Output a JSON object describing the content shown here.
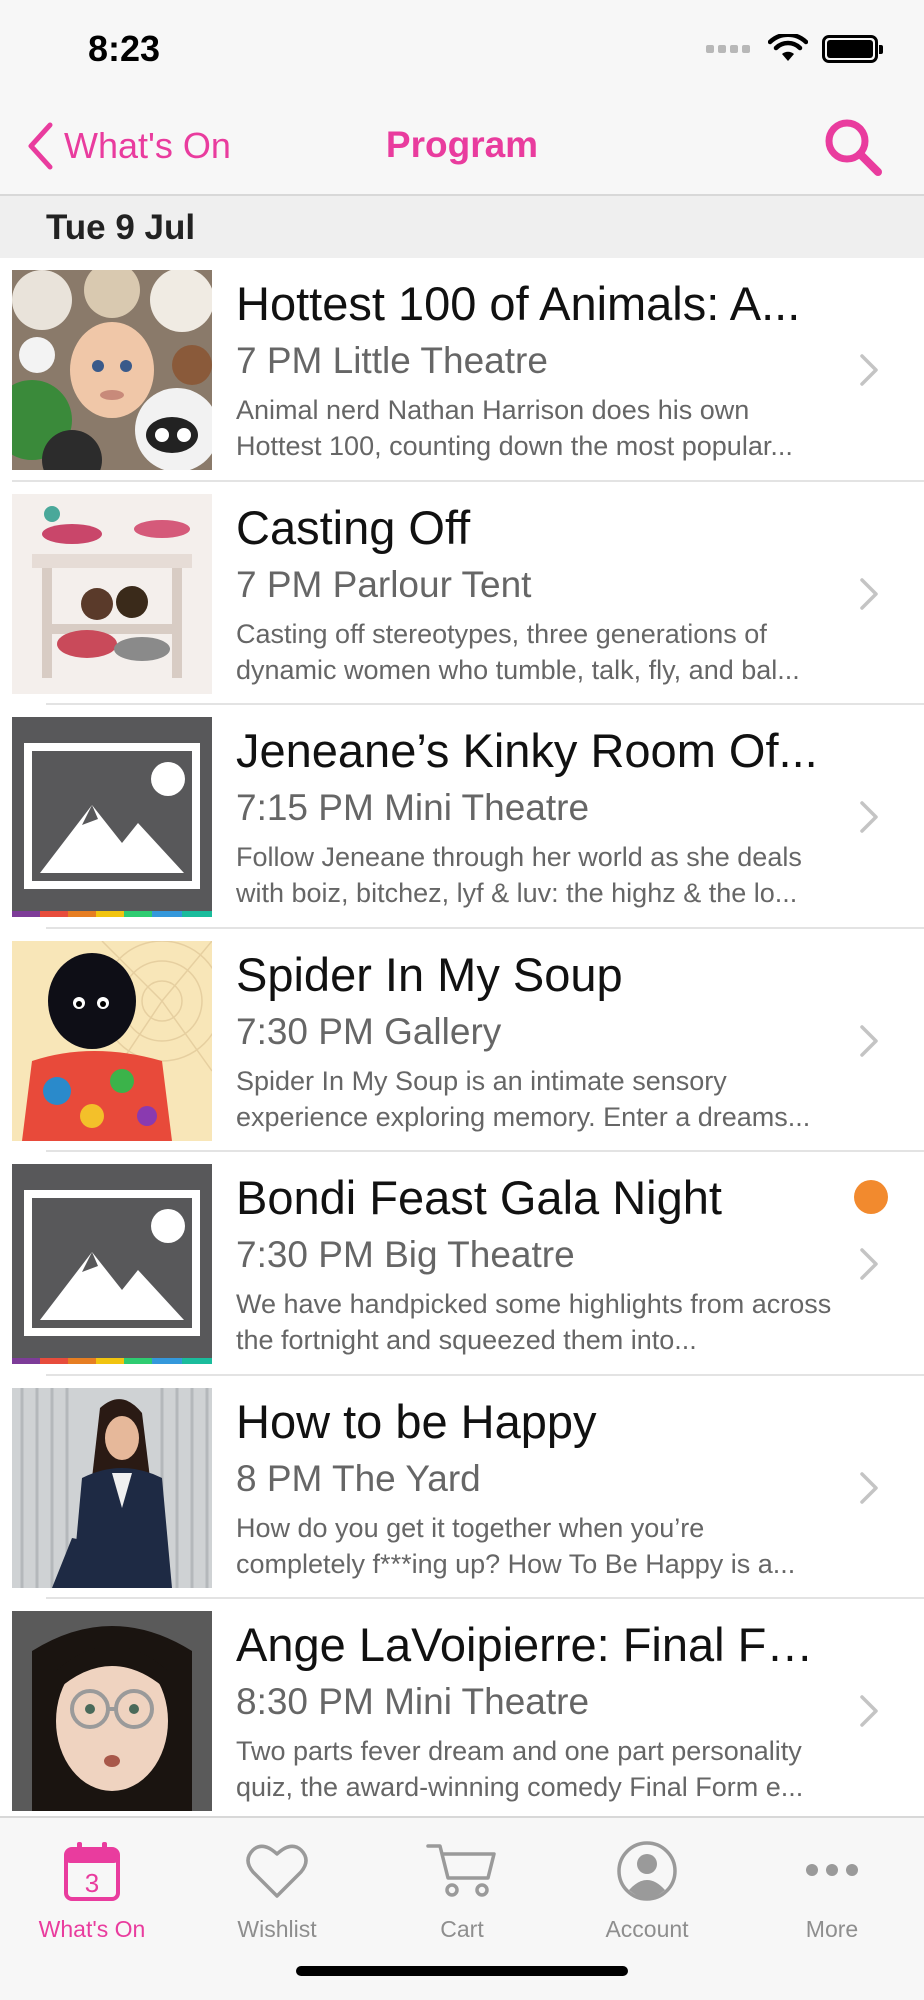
{
  "status_bar": {
    "time": "8:23"
  },
  "nav": {
    "back_label": "What's On",
    "title": "Program",
    "accent_color": "#e93c9e"
  },
  "section": {
    "date": "Tue 9 Jul"
  },
  "events": [
    {
      "title": "Hottest 100 of Animals: A...",
      "meta": "7 PM Little Theatre",
      "description": "Animal nerd Nathan Harrison does his own Hottest 100, counting down the most popular...",
      "thumbnail": "plush-animals-photo",
      "has_dot": false
    },
    {
      "title": "Casting Off",
      "meta": "7 PM Parlour Tent",
      "description": "Casting off stereotypes, three generations of dynamic women who tumble, talk, fly, and bal...",
      "thumbnail": "acrobats-photo",
      "has_dot": false
    },
    {
      "title": "Jeneane’s Kinky Room Of...",
      "meta": "7:15 PM Mini Theatre",
      "description": "Follow Jeneane through her world as she deals with boiz, bitchez, lyf & luv: the highz & the lo...",
      "thumbnail": "placeholder-image",
      "has_dot": false
    },
    {
      "title": "Spider In My Soup",
      "meta": "7:30 PM Gallery",
      "description": "Spider In My Soup is an intimate sensory experience exploring memory. Enter a dreams...",
      "thumbnail": "spider-web-photo",
      "has_dot": false
    },
    {
      "title": "Bondi Feast Gala Night",
      "meta": "7:30 PM Big Theatre",
      "description": "We have handpicked some highlights from across the fortnight and squeezed them into...",
      "thumbnail": "placeholder-image",
      "has_dot": true,
      "dot_color": "#f28a2e"
    },
    {
      "title": "How to be Happy",
      "meta": "8 PM The Yard",
      "description": "How do you get it together when you’re completely f***ing up? How To Be Happy is a...",
      "thumbnail": "woman-in-suit-photo",
      "has_dot": false
    },
    {
      "title": "Ange LaVoipierre: Final Form",
      "meta": "8:30 PM Mini Theatre",
      "description": "Two parts fever dream and one part personality quiz, the award-winning comedy Final Form e...",
      "thumbnail": "woman-glasses-photo",
      "has_dot": false
    }
  ],
  "tab_bar": {
    "tabs": [
      {
        "label": "What's On",
        "icon": "calendar-icon",
        "badge": "3",
        "active": true
      },
      {
        "label": "Wishlist",
        "icon": "heart-icon",
        "active": false
      },
      {
        "label": "Cart",
        "icon": "cart-icon",
        "active": false
      },
      {
        "label": "Account",
        "icon": "account-icon",
        "active": false
      },
      {
        "label": "More",
        "icon": "more-icon",
        "active": false
      }
    ]
  }
}
